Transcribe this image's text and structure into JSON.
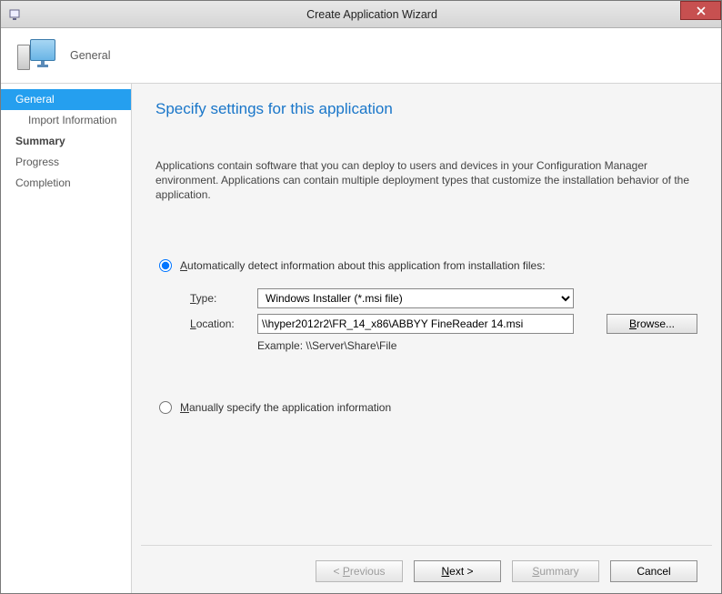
{
  "titlebar": {
    "title": "Create Application Wizard"
  },
  "banner": {
    "label": "General"
  },
  "sidebar": {
    "items": [
      {
        "label": "General",
        "selected": true,
        "sub": false,
        "bold": false
      },
      {
        "label": "Import Information",
        "selected": false,
        "sub": true,
        "bold": false
      },
      {
        "label": "Summary",
        "selected": false,
        "sub": false,
        "bold": true
      },
      {
        "label": "Progress",
        "selected": false,
        "sub": false,
        "bold": false
      },
      {
        "label": "Completion",
        "selected": false,
        "sub": false,
        "bold": false
      }
    ]
  },
  "main": {
    "heading": "Specify settings for this application",
    "description": "Applications contain software that you can deploy to users and devices in your Configuration Manager environment. Applications can contain multiple deployment types that customize the installation behavior of the application.",
    "radio_auto_label": "Automatically detect information about this application from installation files:",
    "radio_manual_label": "Manually specify the application information",
    "type_label": "Type:",
    "type_value": "Windows Installer (*.msi file)",
    "location_label": "Location:",
    "location_value": "\\\\hyper2012r2\\FR_14_x86\\ABBYY FineReader 14.msi",
    "example_label": "Example: \\\\Server\\Share\\File",
    "browse_label": "Browse..."
  },
  "footer": {
    "previous": "Previous",
    "next": "Next >",
    "summary": "Summary",
    "cancel": "Cancel"
  }
}
